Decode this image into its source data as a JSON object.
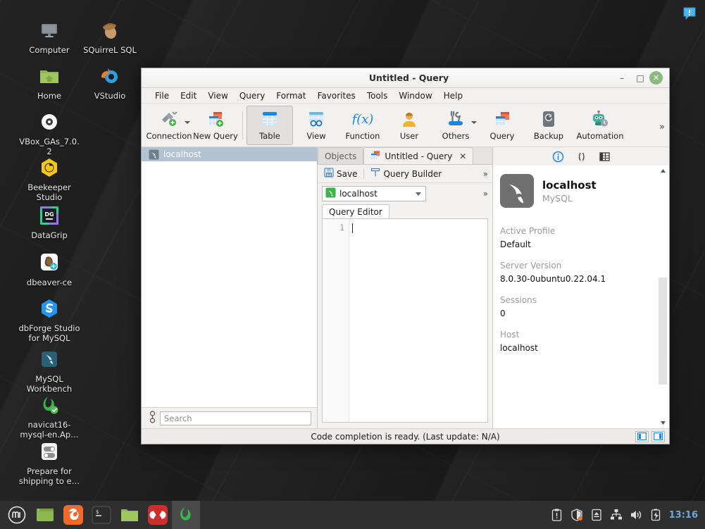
{
  "desktop": {
    "icons": [
      {
        "label": "Computer",
        "icon": "monitor-icon"
      },
      {
        "label": "SQuirreL SQL",
        "icon": "acorn-icon"
      },
      {
        "label": "Home",
        "icon": "home-folder-icon"
      },
      {
        "label": "VStudio",
        "icon": "vstudio-icon"
      },
      {
        "label": "VBox_GAs_7.0.2",
        "icon": "disc-icon"
      },
      {
        "label": "Beekeeper Studio",
        "icon": "beekeeper-icon"
      },
      {
        "label": "DataGrip",
        "icon": "datagrip-icon"
      },
      {
        "label": "dbeaver-ce",
        "icon": "dbeaver-icon"
      },
      {
        "label": "dbForge Studio for MySQL",
        "icon": "dbforge-icon"
      },
      {
        "label": "MySQL Workbench",
        "icon": "mysql-workbench-icon"
      },
      {
        "label": "navicat16-mysql-en.Ap…",
        "icon": "navicat-icon"
      },
      {
        "label": "Prepare for shipping to e…",
        "icon": "toggles-icon"
      }
    ],
    "notification_icon": "alert-bubble-icon"
  },
  "window": {
    "title": "Untitled - Query",
    "minimize_label": "–",
    "maximize_label": "□",
    "close_label": "✕",
    "menus": [
      {
        "label": "File",
        "accel": "F"
      },
      {
        "label": "Edit",
        "accel": "E"
      },
      {
        "label": "View",
        "accel": "V"
      },
      {
        "label": "Query",
        "accel": "Q"
      },
      {
        "label": "Format",
        "accel": "o"
      },
      {
        "label": "Favorites",
        "accel": "a"
      },
      {
        "label": "Tools",
        "accel": "T"
      },
      {
        "label": "Window",
        "accel": "W"
      },
      {
        "label": "Help",
        "accel": "H"
      }
    ]
  },
  "toolbar": {
    "items": [
      {
        "label": "Connection",
        "icon": "connection-plug-icon",
        "caret": true,
        "active": false
      },
      {
        "label": "New Query",
        "icon": "new-query-icon",
        "caret": false,
        "active": false
      },
      {
        "label": "Table",
        "icon": "table-icon",
        "caret": false,
        "active": true
      },
      {
        "label": "View",
        "icon": "view-icon",
        "caret": false,
        "active": false
      },
      {
        "label": "Function",
        "icon": "function-icon",
        "caret": false,
        "active": false
      },
      {
        "label": "User",
        "icon": "user-icon",
        "caret": false,
        "active": false
      },
      {
        "label": "Others",
        "icon": "others-tools-icon",
        "caret": true,
        "active": false
      },
      {
        "label": "Query",
        "icon": "query-icon",
        "caret": false,
        "active": false
      },
      {
        "label": "Backup",
        "icon": "backup-icon",
        "caret": false,
        "active": false
      },
      {
        "label": "Automation",
        "icon": "automation-robot-icon",
        "caret": false,
        "active": false
      }
    ],
    "overflow_label": "»"
  },
  "tree": {
    "rows": [
      {
        "label": "localhost",
        "icon": "mysql-dolphin-icon",
        "selected": true
      }
    ],
    "search_placeholder": "Search",
    "search_value": "",
    "filter_icon": "filter-connect-icon"
  },
  "center": {
    "tabs": [
      {
        "label": "Objects",
        "icon": "",
        "active": false,
        "closable": false
      },
      {
        "label": "Untitled - Query",
        "icon": "query-doc-icon",
        "active": true,
        "closable": true
      }
    ],
    "tab_close_label": "✕",
    "query_toolbar": {
      "save_label": "Save",
      "save_icon": "save-disk-icon",
      "builder_label": "Query Builder",
      "builder_icon": "query-builder-icon",
      "overflow_label": "»"
    },
    "connection_select": {
      "value": "localhost",
      "icon": "mysql-green-icon",
      "overflow_label": "»"
    },
    "editor_tab_label": "Query Editor",
    "editor": {
      "line_numbers": [
        "1"
      ],
      "content": ""
    }
  },
  "info": {
    "tabs": [
      {
        "icon": "info-circle-icon",
        "active": true
      },
      {
        "icon": "parentheses-icon",
        "active": false
      },
      {
        "icon": "grid-table-icon",
        "active": false
      }
    ],
    "avatar_icon": "mysql-dolphin-large-icon",
    "name": "localhost",
    "subtitle": "MySQL",
    "fields": [
      {
        "label": "Active Profile",
        "value": "Default"
      },
      {
        "label": "Server Version",
        "value": "8.0.30-0ubuntu0.22.04.1"
      },
      {
        "label": "Sessions",
        "value": "0"
      },
      {
        "label": "Host",
        "value": "localhost"
      }
    ],
    "scroll_up_label": "▲",
    "scroll_down_label": "▼"
  },
  "statusbar": {
    "text": "Code completion is ready. (Last update: N/A)",
    "buttons": [
      {
        "icon": "toggle-left-panel-icon"
      },
      {
        "icon": "toggle-right-panel-icon"
      }
    ]
  },
  "taskbar": {
    "menu_icon": "linux-mint-menu-icon",
    "launchers": [
      {
        "icon": "show-desktop-icon",
        "active": false
      },
      {
        "icon": "firefox-icon",
        "active": false
      },
      {
        "icon": "terminal-icon",
        "active": false
      },
      {
        "icon": "files-folder-icon",
        "active": false
      },
      {
        "icon": "xterm-red-icon",
        "active": false
      },
      {
        "icon": "navicat-taskbar-icon",
        "active": true
      }
    ],
    "tray": [
      {
        "icon": "clipboard-icon"
      },
      {
        "icon": "shield-update-icon"
      },
      {
        "icon": "eject-media-icon"
      },
      {
        "icon": "network-icon"
      },
      {
        "icon": "volume-icon"
      },
      {
        "icon": "battery-charging-icon"
      }
    ],
    "clock": "13:16"
  },
  "colors": {
    "accent_blue": "#1a88e0",
    "selection": "#b2c4d3",
    "mint_green": "#8cb97f",
    "clock_blue": "#6fa8d8"
  }
}
